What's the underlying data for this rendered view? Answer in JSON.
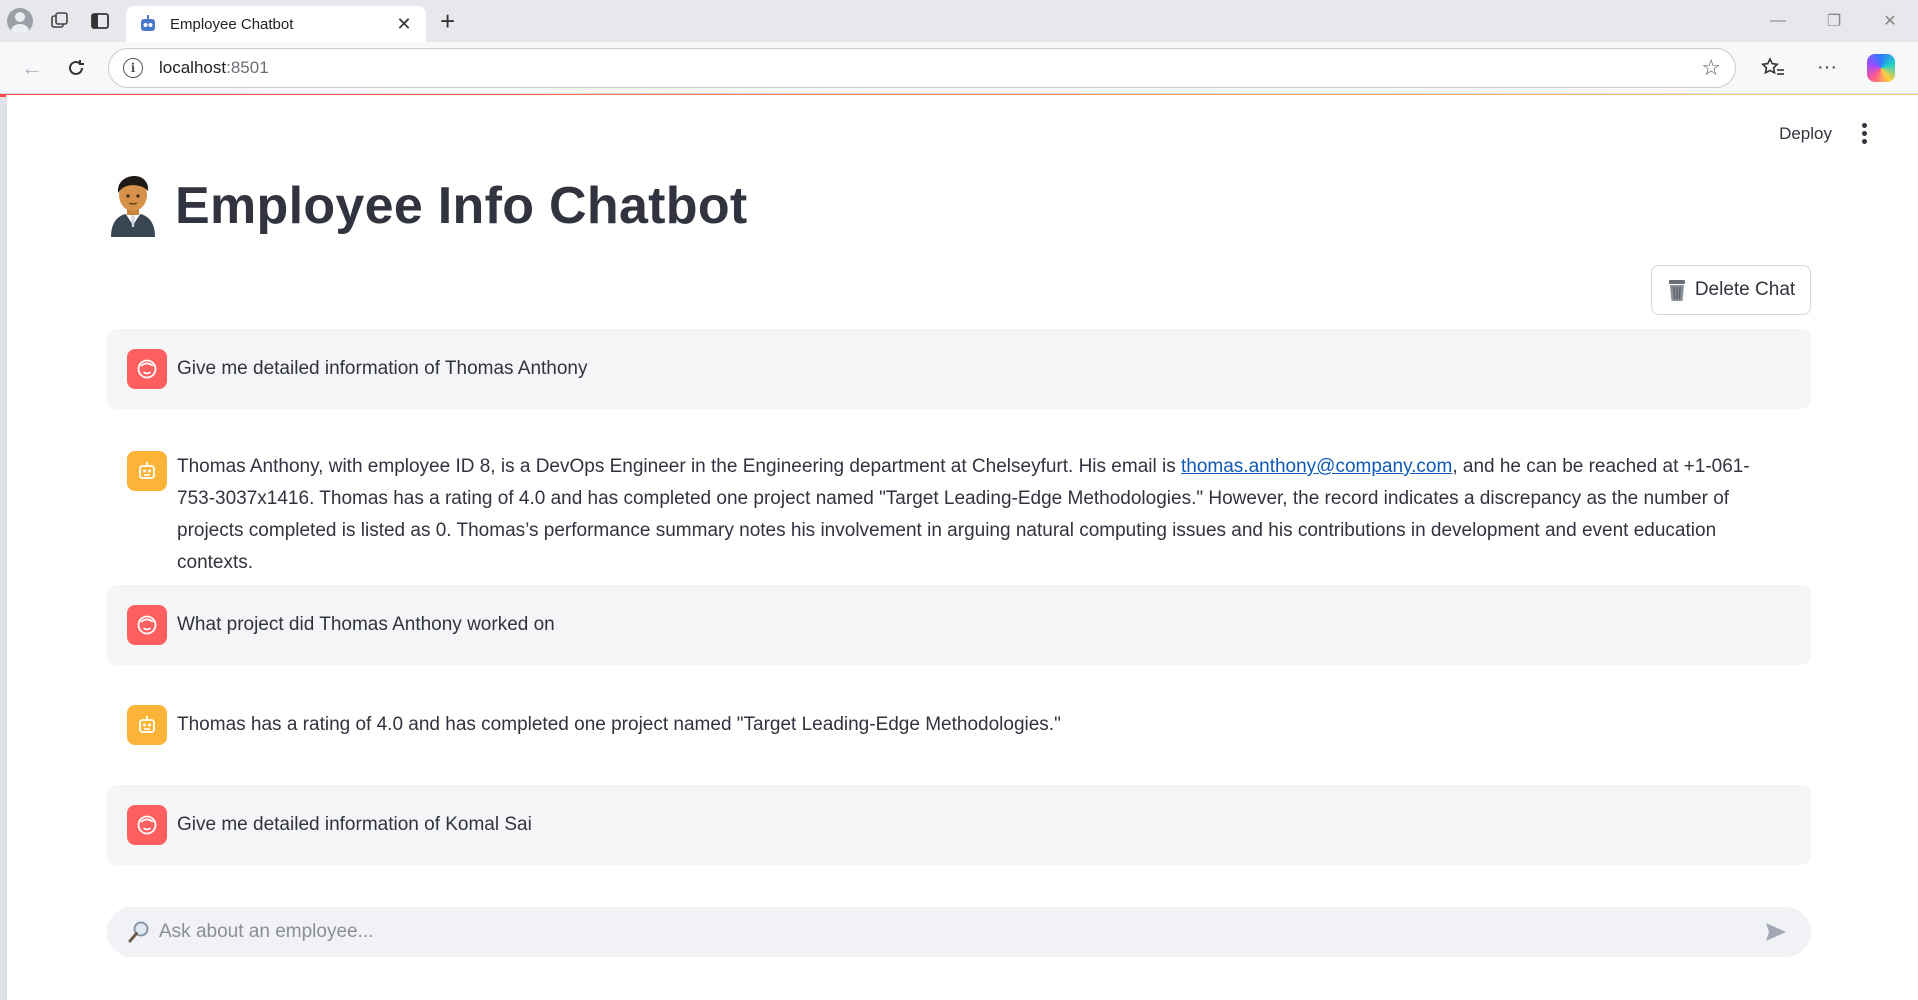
{
  "browser": {
    "tab_title": "Employee Chatbot",
    "url_host": "localhost",
    "url_port": ":8501"
  },
  "app": {
    "deploy_label": "Deploy",
    "title": "Employee Info Chatbot",
    "delete_button_label": "Delete Chat",
    "chat_placeholder": "Ask about an employee..."
  },
  "messages": [
    {
      "role": "user",
      "text": "Give me detailed information of Thomas Anthony"
    },
    {
      "role": "assistant",
      "text_before": "Thomas Anthony, with employee ID 8, is a DevOps Engineer in the Engineering department at Chelseyfurt. His email is ",
      "link": "thomas.anthony@company.com",
      "text_after": ", and he can be reached at +1-061-753-3037x1416. Thomas has a rating of 4.0 and has completed one project named \"Target Leading-Edge Methodologies.\" However, the record indicates a discrepancy as the number of projects completed is listed as 0. Thomas’s performance summary notes his involvement in arguing natural computing issues and his contributions in development and event education contexts."
    },
    {
      "role": "user",
      "text": "What project did Thomas Anthony worked on"
    },
    {
      "role": "assistant",
      "text": "Thomas has a rating of 4.0 and has completed one project named \"Target Leading-Edge Methodologies.\""
    },
    {
      "role": "user",
      "text": "Give me detailed information of Komal Sai"
    }
  ],
  "colors": {
    "user_avatar": "#ff5f5f",
    "bot_avatar": "#fbb438",
    "user_bubble": "#f4f5f7",
    "link": "#0f5ab8"
  }
}
